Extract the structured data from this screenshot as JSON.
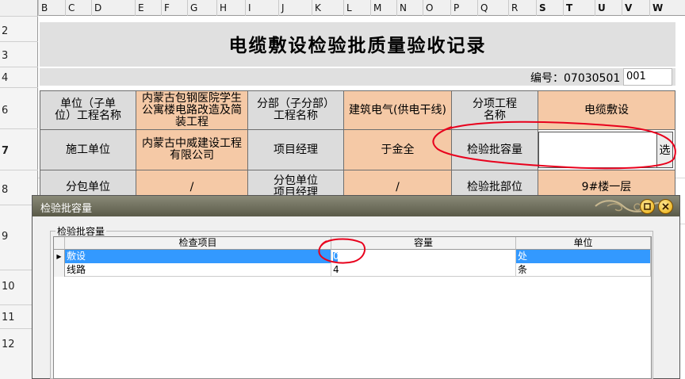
{
  "spreadsheet": {
    "columns": [
      "B",
      "C",
      "D",
      "E",
      "F",
      "G",
      "H",
      "I",
      "J",
      "K",
      "L",
      "M",
      "N",
      "O",
      "P",
      "Q",
      "R",
      "S",
      "T",
      "U",
      "V",
      "W"
    ],
    "rows": [
      "2",
      "3",
      "4",
      "6",
      "7",
      "8",
      "9",
      "10",
      "11",
      "12"
    ]
  },
  "form": {
    "title": "电缆敷设检验批质量验收记录",
    "number_label": "编号：07030501",
    "number_value": "001",
    "unit_project_label": "单位（子单位）工程名称",
    "unit_project_value": "内蒙古包钢医院学生公寓楼电路改造及简装工程",
    "sub_project_label": "分部（子分部）工程名称",
    "sub_project_value": "建筑电气(供电干线)",
    "item_project_label": "分项工程名称",
    "item_project_value": "电缆敷设",
    "construction_unit_label": "施工单位",
    "construction_unit_value": "内蒙古中威建设工程有限公司",
    "project_manager_label": "项目经理",
    "project_manager_value": "于金全",
    "batch_capacity_label": "检验批容量",
    "batch_capacity_value": "",
    "select_button": "选",
    "subcontract_unit_label": "分包单位",
    "subcontract_unit_value": "/",
    "subcontract_manager_label": "分包单位项目经理",
    "subcontract_manager_value": "/",
    "batch_location_label": "检验批部位",
    "batch_location_value": "9#楼一层"
  },
  "dialog": {
    "title": "检验批容量",
    "group_label": "检验批容量",
    "columns": [
      "检查项目",
      "容量",
      "单位"
    ],
    "rows": [
      {
        "item": "敷设",
        "capacity": "0",
        "unit": "处"
      },
      {
        "item": "线路",
        "capacity": "4",
        "unit": "条"
      }
    ],
    "current_row_marker": "▶"
  },
  "colors": {
    "label_bg": "#dcdcdc",
    "value_bg": "#f5c9a6",
    "selection": "#3399ff",
    "annotation": "#e8001c"
  }
}
